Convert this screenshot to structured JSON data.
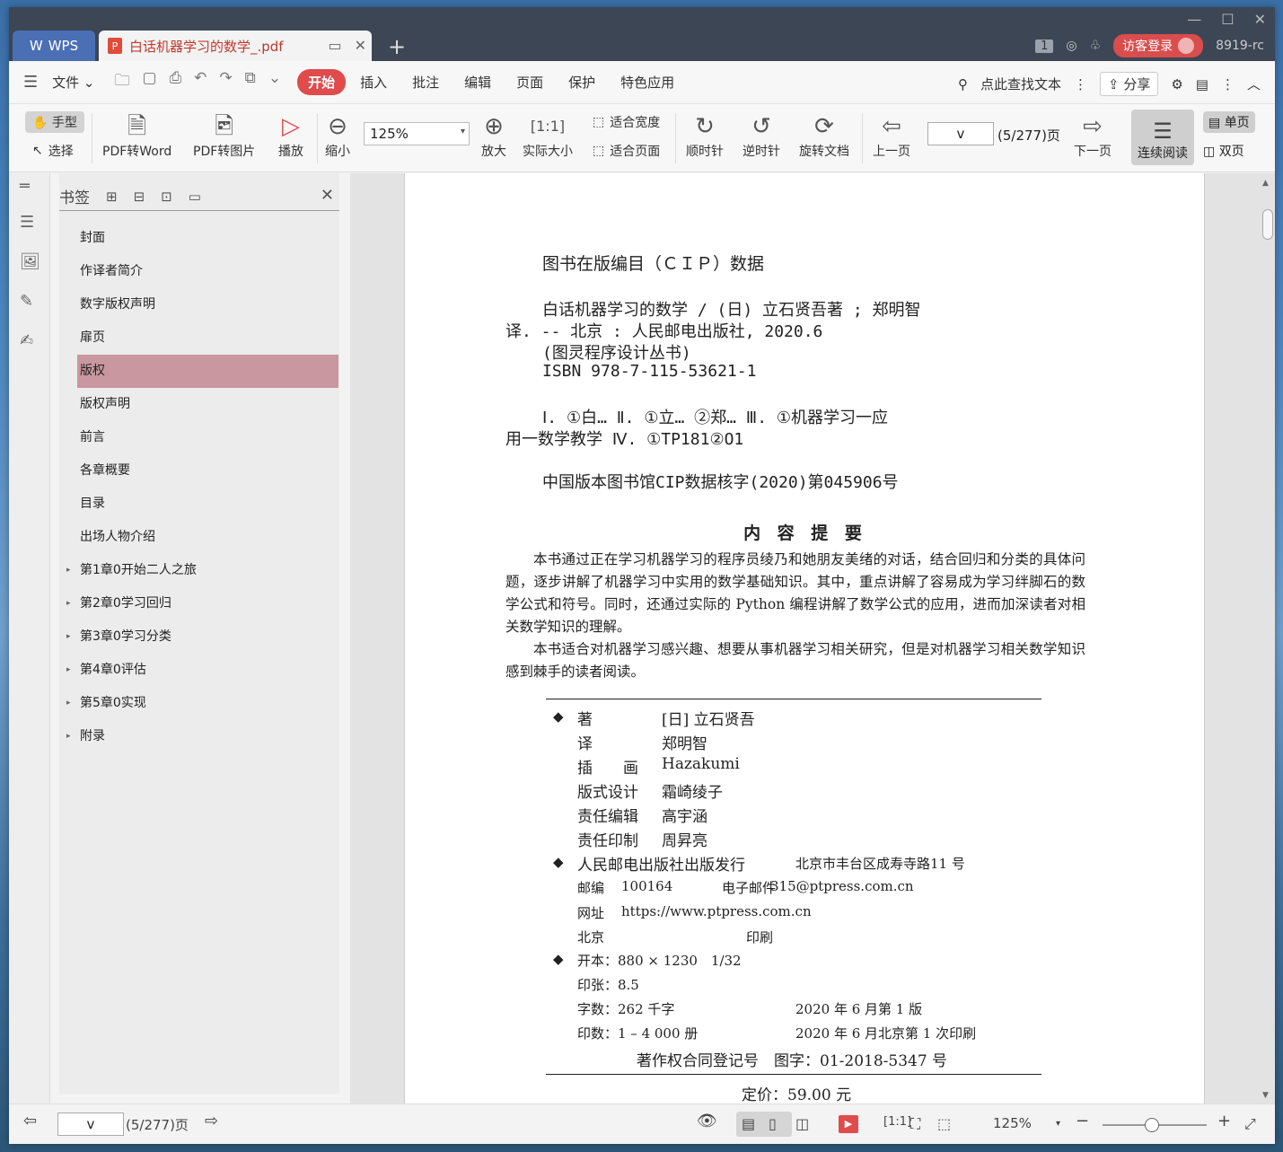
{
  "titlebar": {
    "app_tab": "WPS",
    "doc_tab": "白话机器学习的数学_.pdf",
    "badge": "1",
    "login": "访客登录",
    "user_id": "8919-rc"
  },
  "menubar": {
    "file": "文件",
    "items": [
      "开始",
      "插入",
      "批注",
      "编辑",
      "页面",
      "保护",
      "特色应用"
    ],
    "search": "点此查找文本",
    "share": "分享"
  },
  "toolbar": {
    "hand": "手型",
    "select": "选择",
    "pdf_to_word": "PDF转Word",
    "pdf_to_image": "PDF转图片",
    "play": "播放",
    "zoom_out": "缩小",
    "zoom_value": "125%",
    "zoom_in": "放大",
    "actual_size": "实际大小",
    "fit_width": "适合宽度",
    "fit_page": "适合页面",
    "clockwise": "顺时针",
    "counterclockwise": "逆时针",
    "rotate_doc": "旋转文档",
    "prev_page": "上一页",
    "page_value": "v",
    "page_count": "(5/277)页",
    "next_page": "下一页",
    "continuous": "连续阅读",
    "single": "单页",
    "double": "双页"
  },
  "bookmarks": {
    "title": "书签",
    "items": [
      {
        "label": "封面"
      },
      {
        "label": "作译者简介"
      },
      {
        "label": "数字版权声明"
      },
      {
        "label": "扉页"
      },
      {
        "label": "版权"
      },
      {
        "label": "版权声明"
      },
      {
        "label": "前言"
      },
      {
        "label": "各章概要"
      },
      {
        "label": "目录"
      },
      {
        "label": "出场人物介绍"
      },
      {
        "label": "第1章0开始二人之旅"
      },
      {
        "label": "第2章0学习回归"
      },
      {
        "label": "第3章0学习分类"
      },
      {
        "label": "第4章0评估"
      },
      {
        "label": "第5章0实现"
      },
      {
        "label": "附录"
      }
    ]
  },
  "page": {
    "cip_title": "图书在版编目（ＣＩＰ）数据",
    "cip_lines": [
      "白话机器学习的数学 / (日) 立石贤吾著 ; 郑明智",
      "译. -- 北京 : 人民邮电出版社, 2020.6",
      "(图灵程序设计丛书)",
      "ISBN 978-7-115-53621-1",
      "Ⅰ. ①白… Ⅱ. ①立… ②郑… Ⅲ. ①机器学习一应",
      "用一数学教学 Ⅳ. ①TP181②O1",
      "中国版本图书馆CIP数据核字(2020)第045906号"
    ],
    "content_title": "内 容 提 要",
    "para1": "本书通过正在学习机器学习的程序员绫乃和她朋友美绪的对话，结合回归和分类的具体问题，逐步讲解了机器学习中实用的数学基础知识。其中，重点讲解了容易成为学习绊脚石的数学公式和符号。同时，还通过实际的 Python 编程讲解了数学公式的应用，进而加深读者对相关数学知识的理解。",
    "para2": "本书适合对机器学习感兴趣、想要从事机器学习相关研究，但是对机器学习相关数学知识感到棘手的读者阅读。",
    "credits": [
      {
        "role": "著",
        "name": "[日] 立石贤吾"
      },
      {
        "role": "译",
        "name": "郑明智"
      },
      {
        "role": "插　　画",
        "name": "Hazakumi"
      },
      {
        "role": "版式设计",
        "name": "霜崎绫子"
      },
      {
        "role": "责任编辑",
        "name": "高宇涵"
      },
      {
        "role": "责任印制",
        "name": "周昇亮"
      }
    ],
    "publisher": "人民邮电出版社出版发行",
    "address": "北京市丰台区成寿寺路11 号",
    "postcode_label": "邮编",
    "postcode": "100164",
    "email_label": "电子邮件",
    "email": "315@ptpress.com.cn",
    "web_label": "网址",
    "web": "https://www.ptpress.com.cn",
    "city": "北京",
    "print": "印刷",
    "format": "开本：880 × 1230　1/32",
    "sheets": "印张：8.5",
    "words": "字数：262 千字",
    "edition": "2020 年 6 月第 1 版",
    "copies": "印数：1 – 4 000 册",
    "printing": "2020 年 6 月北京第 1 次印刷",
    "registration": "著作权合同登记号　图字：01-2018-5347 号",
    "price": "定价：59.00 元"
  },
  "statusbar": {
    "page_value": "v",
    "page_count": "(5/277)页",
    "zoom": "125%"
  }
}
